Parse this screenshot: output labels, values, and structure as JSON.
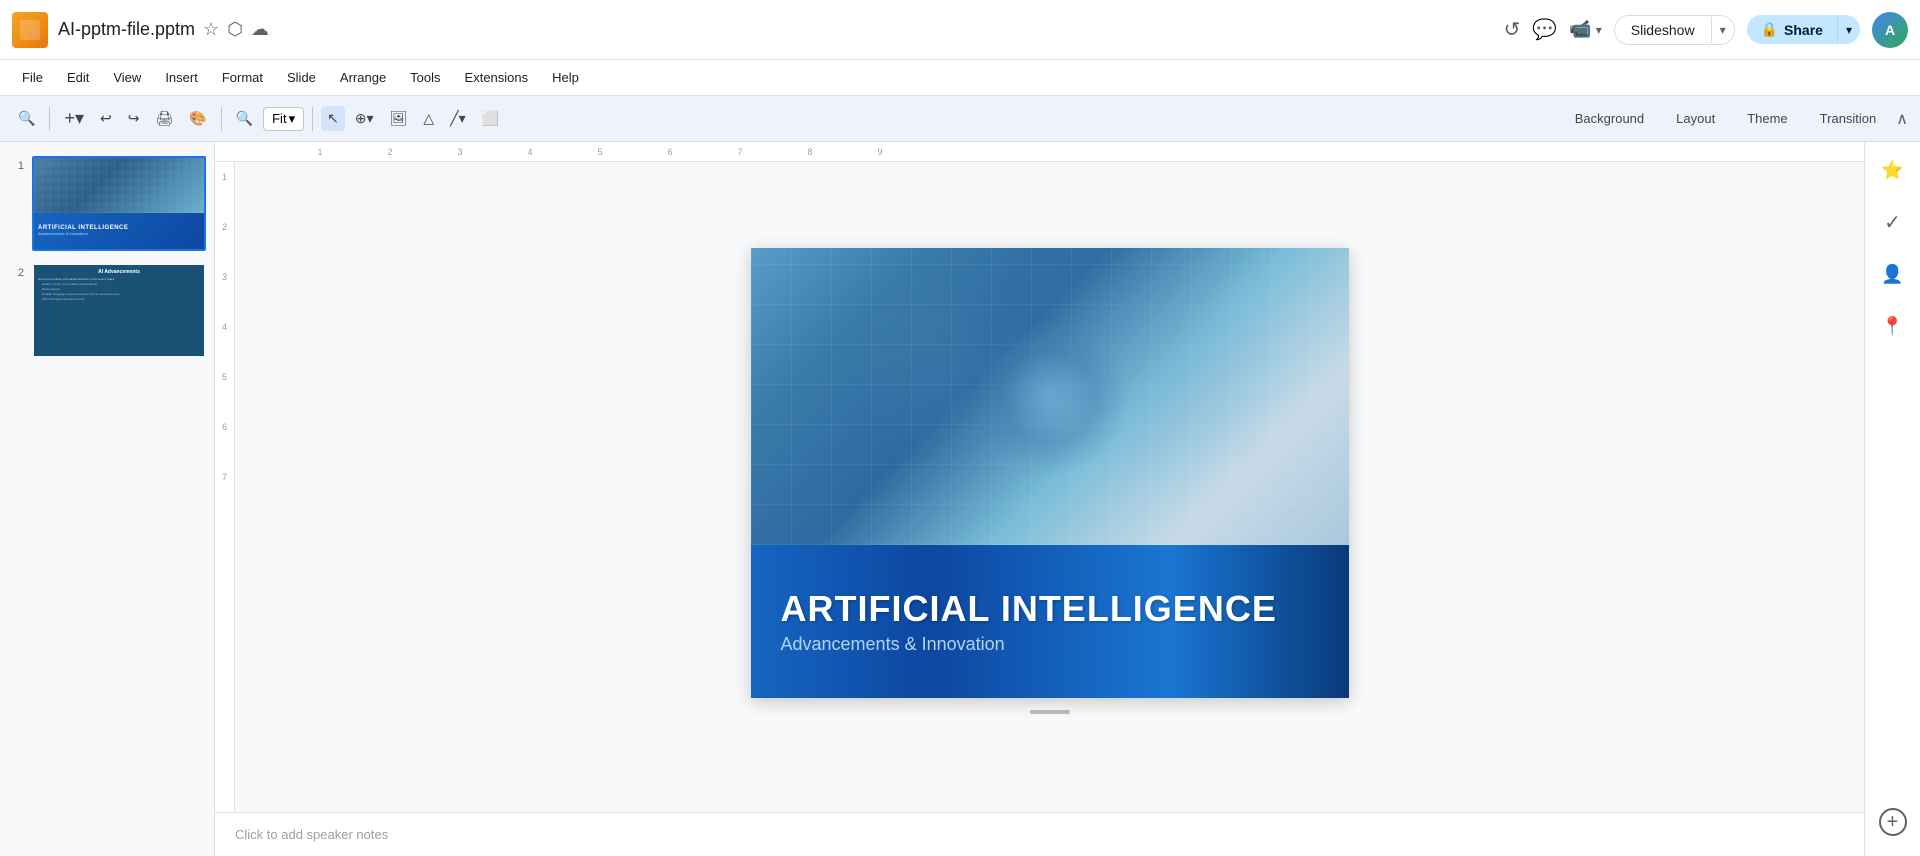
{
  "titleBar": {
    "appLogo": "slides-logo",
    "fileName": "AI-pptm-file.pptm",
    "starIcon": "★",
    "folderIcon": "⬡",
    "cloudIcon": "☁",
    "historyIcon": "↺",
    "commentIcon": "💬",
    "meetIcon": "📹",
    "slideshowLabel": "Slideshow",
    "slideshowArrow": "▾",
    "shareIcon": "🔒",
    "shareLabel": "Share",
    "shareArrow": "▾",
    "userInitials": "A"
  },
  "menuBar": {
    "items": [
      "File",
      "Edit",
      "View",
      "Insert",
      "Format",
      "Slide",
      "Arrange",
      "Tools",
      "Extensions",
      "Help"
    ]
  },
  "toolbar": {
    "searchIcon": "🔍",
    "addSlideLabel": "+",
    "undoIcon": "↩",
    "redoIcon": "↪",
    "printIcon": "🖨",
    "paintIcon": "🎨",
    "zoomIcon": "🔍",
    "zoomLabel": "Fit",
    "zoomArrow": "▾",
    "selectIcon": "↖",
    "moveIcon": "⊕",
    "imageIcon": "🖼",
    "shapeIcon": "△",
    "lineIcon": "╱",
    "accessibilityIcon": "⬜",
    "backgroundLabel": "Background",
    "layoutLabel": "Layout",
    "themeLabel": "Theme",
    "transitionLabel": "Transition",
    "collapseIcon": "∧"
  },
  "slides": [
    {
      "number": "1",
      "title": "ARTIFICIAL INTELLIGENCE",
      "subtitle": "Advancements & Innovation",
      "active": true
    },
    {
      "number": "2",
      "title": "AI Advancements",
      "lines": [
        "Here is an outline of AI advancements in the recent years:",
        "Reality check: more realistic expectations",
        "Multimodal AI",
        "Smaller language models and open source advancements",
        "GPU shortages and cloud costs"
      ],
      "active": false
    }
  ],
  "slideCanvas": {
    "mainTitle": "ARTIFICIAL INTELLIGENCE",
    "subtitle": "Advancements & Innovation"
  },
  "ruler": {
    "topMarks": [
      "1",
      "2",
      "3",
      "4",
      "5",
      "6",
      "7",
      "8",
      "9"
    ],
    "leftMarks": [
      "1",
      "2",
      "3",
      "4",
      "5",
      "6",
      "7"
    ]
  },
  "notes": {
    "placeholder": "Click to add speaker notes"
  },
  "rightPanel": {
    "keepIcon": "⭐",
    "taskIcon": "✓",
    "personIcon": "👤",
    "mapIcon": "📍",
    "addIcon": "+"
  }
}
